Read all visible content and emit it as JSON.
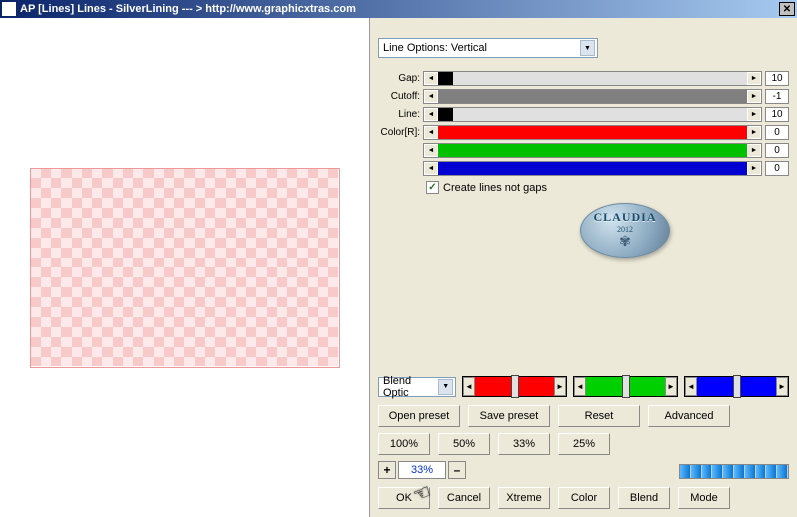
{
  "title": "AP [Lines]  Lines - SilverLining    --- >  http://www.graphicxtras.com",
  "dropdown": {
    "selected": "Line Options: Vertical"
  },
  "sliders": {
    "gap": {
      "label": "Gap:",
      "value": "10",
      "fill_pct": 5,
      "fill_color": "#000000",
      "track_color": "#e0e0e0"
    },
    "cutoff": {
      "label": "Cutoff:",
      "value": "-1",
      "fill_pct": 100,
      "fill_color": "#808080",
      "track_color": "#808080"
    },
    "line": {
      "label": "Line:",
      "value": "10",
      "fill_pct": 5,
      "fill_color": "#000000",
      "track_color": "#e0e0e0"
    },
    "colorR": {
      "label": "Color[R]:",
      "value": "0",
      "fill_pct": 100,
      "fill_color": "#ff0000",
      "track_color": "#ff0000"
    },
    "colorG": {
      "label": "",
      "value": "0",
      "fill_pct": 100,
      "fill_color": "#00c000",
      "track_color": "#00c000"
    },
    "colorB": {
      "label": "",
      "value": "0",
      "fill_pct": 100,
      "fill_color": "#0000d0",
      "track_color": "#0000d0"
    }
  },
  "checkbox": {
    "label": "Create lines not gaps",
    "checked": true
  },
  "watermark": {
    "text": "CLAUDIA",
    "year": "2012"
  },
  "blend_dropdown": {
    "label": "Blend Optic"
  },
  "buttons": {
    "open_preset": "Open preset",
    "save_preset": "Save preset",
    "reset": "Reset",
    "advanced": "Advanced",
    "pct100": "100%",
    "pct50": "50%",
    "pct33": "33%",
    "pct25": "25%",
    "ok": "OK",
    "cancel": "Cancel",
    "xtreme": "Xtreme",
    "color": "Color",
    "blend": "Blend",
    "mode": "Mode"
  },
  "zoom": {
    "plus": "+",
    "minus": "–",
    "value": "33%"
  }
}
